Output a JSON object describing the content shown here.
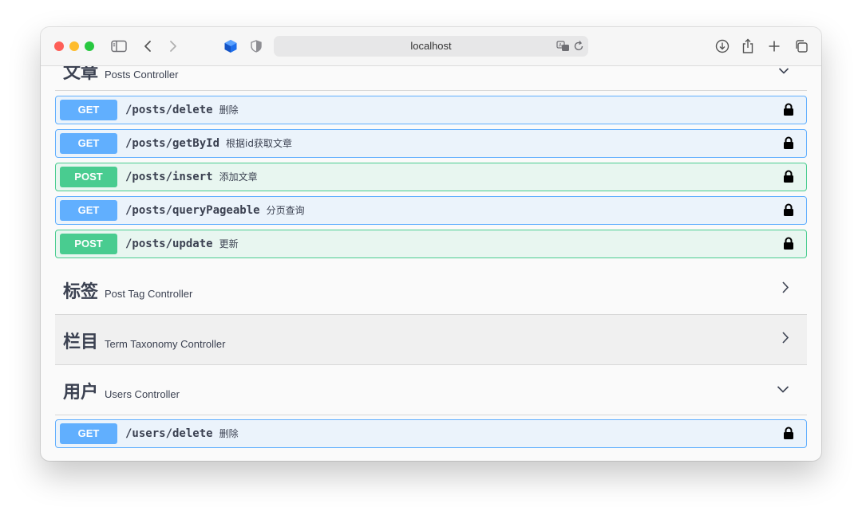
{
  "browser": {
    "address": "localhost"
  },
  "sections": {
    "posts": {
      "title": "文章",
      "description": "Posts Controller",
      "operations": [
        {
          "method": "GET",
          "path": "/posts/delete",
          "summary": "删除"
        },
        {
          "method": "GET",
          "path": "/posts/getById",
          "summary": "根据id获取文章"
        },
        {
          "method": "POST",
          "path": "/posts/insert",
          "summary": "添加文章"
        },
        {
          "method": "GET",
          "path": "/posts/queryPageable",
          "summary": "分页查询"
        },
        {
          "method": "POST",
          "path": "/posts/update",
          "summary": "更新"
        }
      ]
    },
    "tags": {
      "title": "标签",
      "description": "Post Tag Controller"
    },
    "taxonomy": {
      "title": "栏目",
      "description": "Term Taxonomy Controller"
    },
    "users": {
      "title": "用户",
      "description": "Users Controller",
      "operations": [
        {
          "method": "GET",
          "path": "/users/delete",
          "summary": "删除"
        }
      ]
    }
  },
  "colors": {
    "get": "#61affe",
    "post": "#49cc90"
  },
  "icons": {
    "lock": "lock-icon",
    "expanded": "chevron-down-icon",
    "collapsed": "chevron-right-icon"
  }
}
